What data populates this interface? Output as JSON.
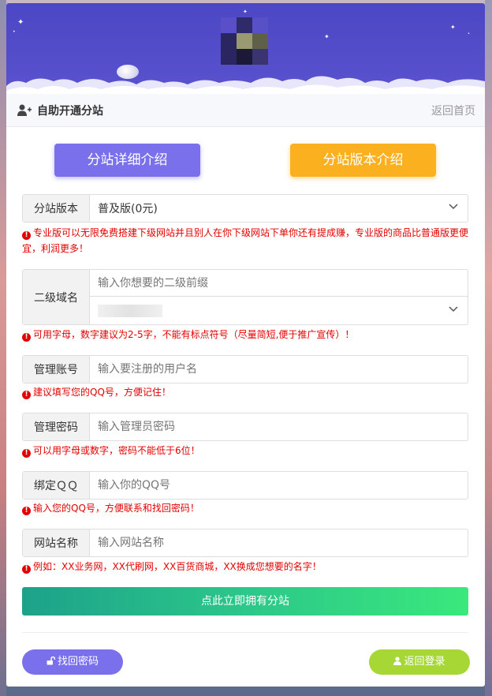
{
  "header": {
    "title": "自助开通分站",
    "back_home": "返回首页"
  },
  "top_buttons": {
    "detail": "分站详细介绍",
    "version": "分站版本介绍"
  },
  "form": {
    "version": {
      "label": "分站版本",
      "value": "普及版(0元)",
      "tip": "专业版可以无限免费搭建下级网站并且别人在你下级网站下单你还有提成赚，专业版的商品比普通版更便宜，利润更多！"
    },
    "domain": {
      "label": "二级域名",
      "placeholder": "输入你想要的二级前缀",
      "tip": "可用字母，数字建议为2-5字，不能有标点符号（尽量简短,便于推广宣传）！"
    },
    "account": {
      "label": "管理账号",
      "placeholder": "输入要注册的用户名",
      "tip": "建议填写您的QQ号，方便记住！"
    },
    "password": {
      "label": "管理密码",
      "placeholder": "输入管理员密码",
      "tip": "可以用字母或数字，密码不能低于6位！"
    },
    "qq": {
      "label": "绑定ＱＱ",
      "placeholder": "输入你的QQ号",
      "tip": "输入您的QQ号，方便联系和找回密码！"
    },
    "site_name": {
      "label": "网站名称",
      "placeholder": "输入网站名称",
      "tip": "例如：XX业务网，XX代刷网，XX百货商城，XX换成您想要的名字！"
    },
    "submit": "点此立即拥有分站"
  },
  "footer": {
    "find_password": "找回密码",
    "back_login": "返回登录"
  },
  "colors": {
    "purple": "#7b70ec",
    "orange": "#fbb020",
    "green_start": "#1ca28a",
    "green_end": "#3ae87c",
    "lime": "#a6d735",
    "tip_red": "#e40000"
  }
}
